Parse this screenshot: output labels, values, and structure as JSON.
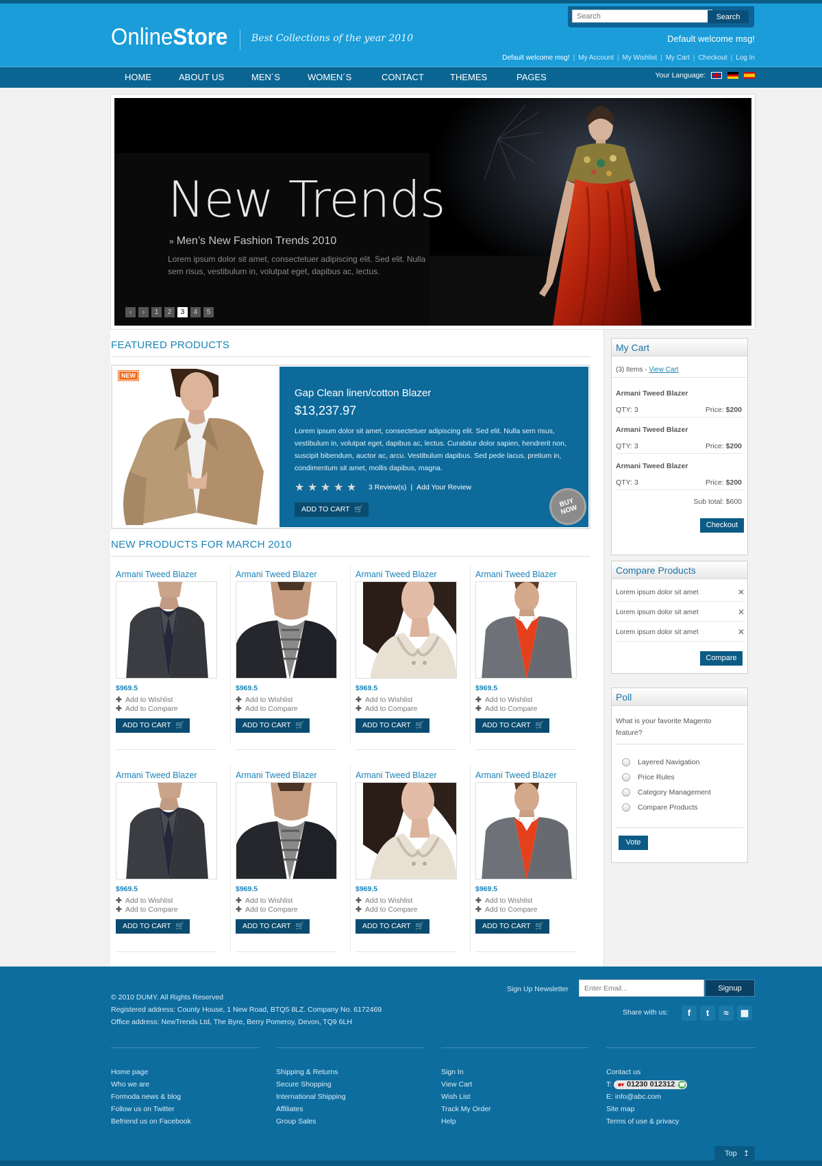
{
  "header": {
    "logo_light": "Online",
    "logo_bold": "Store",
    "tagline": "Best Collections of the year 2010",
    "search_placeholder": "Search",
    "search_button": "Search",
    "welcome": "Default welcome msg!",
    "toplinks": [
      "Default welcome msg!",
      "My Account",
      "My Wishlist",
      "My Cart",
      "Checkout",
      "Log In"
    ]
  },
  "nav": {
    "items": [
      "HOME",
      "ABOUT US",
      "MEN´S",
      "WOMEN´S",
      "CONTACT",
      "THEMES",
      "PAGES"
    ],
    "language_label": "Your Language:",
    "flags": [
      "uk-flag-icon",
      "germany-flag-icon",
      "spain-flag-icon"
    ]
  },
  "slider": {
    "title": "New Trends",
    "subtitle": "Men’s New Fashion Trends 2010",
    "text": "Lorem ipsum dolor sit amet, consectetuer adipiscing elit. Sed elit. Nulla sem risus, vestibulum in, volutpat eget, dapibus ac, lectus.",
    "pager": [
      "1",
      "2",
      "3",
      "4",
      "5"
    ],
    "active_page": "3"
  },
  "featured": {
    "section_title": "FEATURED PRODUCTS",
    "badge": "NEW",
    "name": "Gap Clean linen/cotton Blazer",
    "price": "$13,237.97",
    "description": "Lorem ipsum dolor sit amet, consectetuer adipiscing elit. Sed elit. Nulla sem risus, vestibulum in, volutpat eget, dapibus ac, lectus. Curabitur dolor sapien, hendrerit non, suscipit bibendum, auctor ac, arcu. Vestibulum dapibus. Sed pede lacus, pretium in, condimentum sit amet, mollis dapibus, magna.",
    "rating": 5,
    "reviews": "3 Review(s)",
    "add_review": "Add Your Review",
    "add_to_cart": "ADD TO CART",
    "buy_now": "BUY NOW"
  },
  "new_products": {
    "section_title": "NEW PRODUCTS FOR MARCH 2010",
    "items": [
      {
        "name": "Armani Tweed Blazer",
        "price": "$969.5",
        "wishlist": "Add to Wishlist",
        "compare": "Add to Compare",
        "cart": "ADD TO CART"
      },
      {
        "name": "Armani Tweed Blazer",
        "price": "$969.5",
        "wishlist": "Add to Wishlist",
        "compare": "Add to Compare",
        "cart": "ADD TO CART"
      },
      {
        "name": "Armani Tweed Blazer",
        "price": "$969.5",
        "wishlist": "Add to Wishlist",
        "compare": "Add to Compare",
        "cart": "ADD TO CART"
      },
      {
        "name": "Armani Tweed Blazer",
        "price": "$969.5",
        "wishlist": "Add to Wishlist",
        "compare": "Add to Compare",
        "cart": "ADD TO CART"
      },
      {
        "name": "Armani Tweed Blazer",
        "price": "$969.5",
        "wishlist": "Add to Wishlist",
        "compare": "Add to Compare",
        "cart": "ADD TO CART"
      },
      {
        "name": "Armani Tweed Blazer",
        "price": "$969.5",
        "wishlist": "Add to Wishlist",
        "compare": "Add to Compare",
        "cart": "ADD TO CART"
      },
      {
        "name": "Armani Tweed Blazer",
        "price": "$969.5",
        "wishlist": "Add to Wishlist",
        "compare": "Add to Compare",
        "cart": "ADD TO CART"
      },
      {
        "name": "Armani Tweed Blazer",
        "price": "$969.5",
        "wishlist": "Add to Wishlist",
        "compare": "Add to Compare",
        "cart": "ADD TO CART"
      }
    ]
  },
  "cart": {
    "title": "My Cart",
    "count": "(3) Items - ",
    "view_cart": "View Cart",
    "items": [
      {
        "name": "Armani Tweed Blazer",
        "qty_label": "QTY: 3",
        "price_label": "Price: ",
        "price": "$200"
      },
      {
        "name": "Armani Tweed Blazer",
        "qty_label": "QTY: 3",
        "price_label": "Price: ",
        "price": "$200"
      },
      {
        "name": "Armani Tweed Blazer",
        "qty_label": "QTY: 3",
        "price_label": "Price: ",
        "price": "$200"
      }
    ],
    "subtotal": "Sub total: $600",
    "checkout": "Checkout"
  },
  "compare": {
    "title": "Compare Products",
    "items": [
      "Lorem ipsum dolor sit amet",
      "Lorem ipsum dolor sit amet",
      "Lorem ipsum dolor sit amet"
    ],
    "button": "Compare"
  },
  "poll": {
    "title": "Poll",
    "question": "What is your favorite Magento feature?",
    "options": [
      "Layered Navigation",
      "Price Rules",
      "Category Management",
      "Compare Products"
    ],
    "vote": "Vote"
  },
  "footer": {
    "copyright": "© 2010 DUMY. All Rights Reserved",
    "registered": "Registered address: County House, 1 New Road, BTQ5 8LZ. Company No. 6172469",
    "office": "Office address: NewTrends Ltd, The Byre, Berry Pomeroy, Devon, TQ9 6LH",
    "newsletter_label": "Sign Up Newsletter",
    "newsletter_placeholder": "Enter Email...",
    "signup": "Signup",
    "share_label": "Share with us:",
    "social": [
      "facebook-icon",
      "twitter-icon",
      "rss-icon",
      "delicious-icon"
    ],
    "col1": [
      "Home page",
      "Who we are",
      "Formoda news & blog",
      "Follow us on Twitter",
      "Befriend us on Facebook"
    ],
    "col2": [
      "Shipping & Returns",
      "Secure Shopping",
      "International Shipping",
      "Affiliates",
      "Group Sales"
    ],
    "col3": [
      "Sign In",
      "View Cart",
      "Wish List",
      "Track My Order",
      "Help"
    ],
    "col4": {
      "contact": "Contact us",
      "phone_prefix": "T:",
      "phone": "01230 012312",
      "email": "E: info@abc.com",
      "sitemap": "Site map",
      "terms": "Terms of use & privacy"
    },
    "top": "Top"
  },
  "colors": {
    "header_blue": "#1a9dd9",
    "nav_blue": "#0b6592",
    "footer_blue": "#0e6d9f",
    "accent": "#1a84b8"
  }
}
